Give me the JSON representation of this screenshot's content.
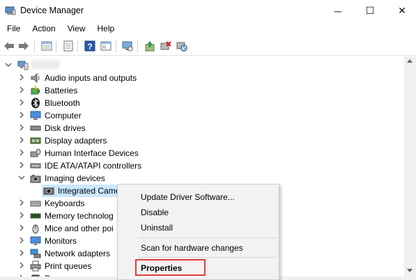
{
  "window": {
    "title": "Device Manager",
    "minimize": "─",
    "maximize": "☐",
    "close": "✕"
  },
  "menu": [
    "File",
    "Action",
    "View",
    "Help"
  ],
  "toolbar_icons": [
    "back-icon",
    "forward-icon",
    "properties-view-icon",
    "grid-icon",
    "help-icon",
    "view-icon",
    "monitor-icon",
    "update-driver-icon",
    "uninstall-icon",
    "scan-hardware-icon"
  ],
  "tree": {
    "root_label": "",
    "categories": [
      {
        "label": "Audio inputs and outputs",
        "icon": "speaker-icon",
        "expanded": false
      },
      {
        "label": "Batteries",
        "icon": "battery-icon",
        "expanded": false
      },
      {
        "label": "Bluetooth",
        "icon": "bluetooth-icon",
        "expanded": false
      },
      {
        "label": "Computer",
        "icon": "computer-icon",
        "expanded": false
      },
      {
        "label": "Disk drives",
        "icon": "disk-icon",
        "expanded": false
      },
      {
        "label": "Display adapters",
        "icon": "display-adapter-icon",
        "expanded": false
      },
      {
        "label": "Human Interface Devices",
        "icon": "hid-icon",
        "expanded": false
      },
      {
        "label": "IDE ATA/ATAPI controllers",
        "icon": "ide-icon",
        "expanded": false
      },
      {
        "label": "Imaging devices",
        "icon": "camera-icon",
        "expanded": true
      },
      {
        "label": "Integrated Came",
        "icon": "webcam-icon",
        "child": true,
        "selected": true
      },
      {
        "label": "Keyboards",
        "icon": "keyboard-icon",
        "expanded": false
      },
      {
        "label": "Memory technolog",
        "icon": "memory-icon",
        "expanded": false
      },
      {
        "label": "Mice and other poi",
        "icon": "mouse-icon",
        "expanded": false
      },
      {
        "label": "Monitors",
        "icon": "monitor-icon",
        "expanded": false
      },
      {
        "label": "Network adapters",
        "icon": "network-icon",
        "expanded": false
      },
      {
        "label": "Print queues",
        "icon": "printer-icon",
        "expanded": false
      },
      {
        "label": "P",
        "icon": "processor-icon",
        "expanded": false
      }
    ]
  },
  "context_menu": {
    "items": [
      "Update Driver Software...",
      "Disable",
      "Uninstall",
      "Scan for hardware changes",
      "Properties"
    ],
    "highlighted": "Properties",
    "highlight_color": "#e03a3a"
  },
  "colors": {
    "selection": "#cce8ff",
    "menu_bg": "#f2f2f2"
  }
}
